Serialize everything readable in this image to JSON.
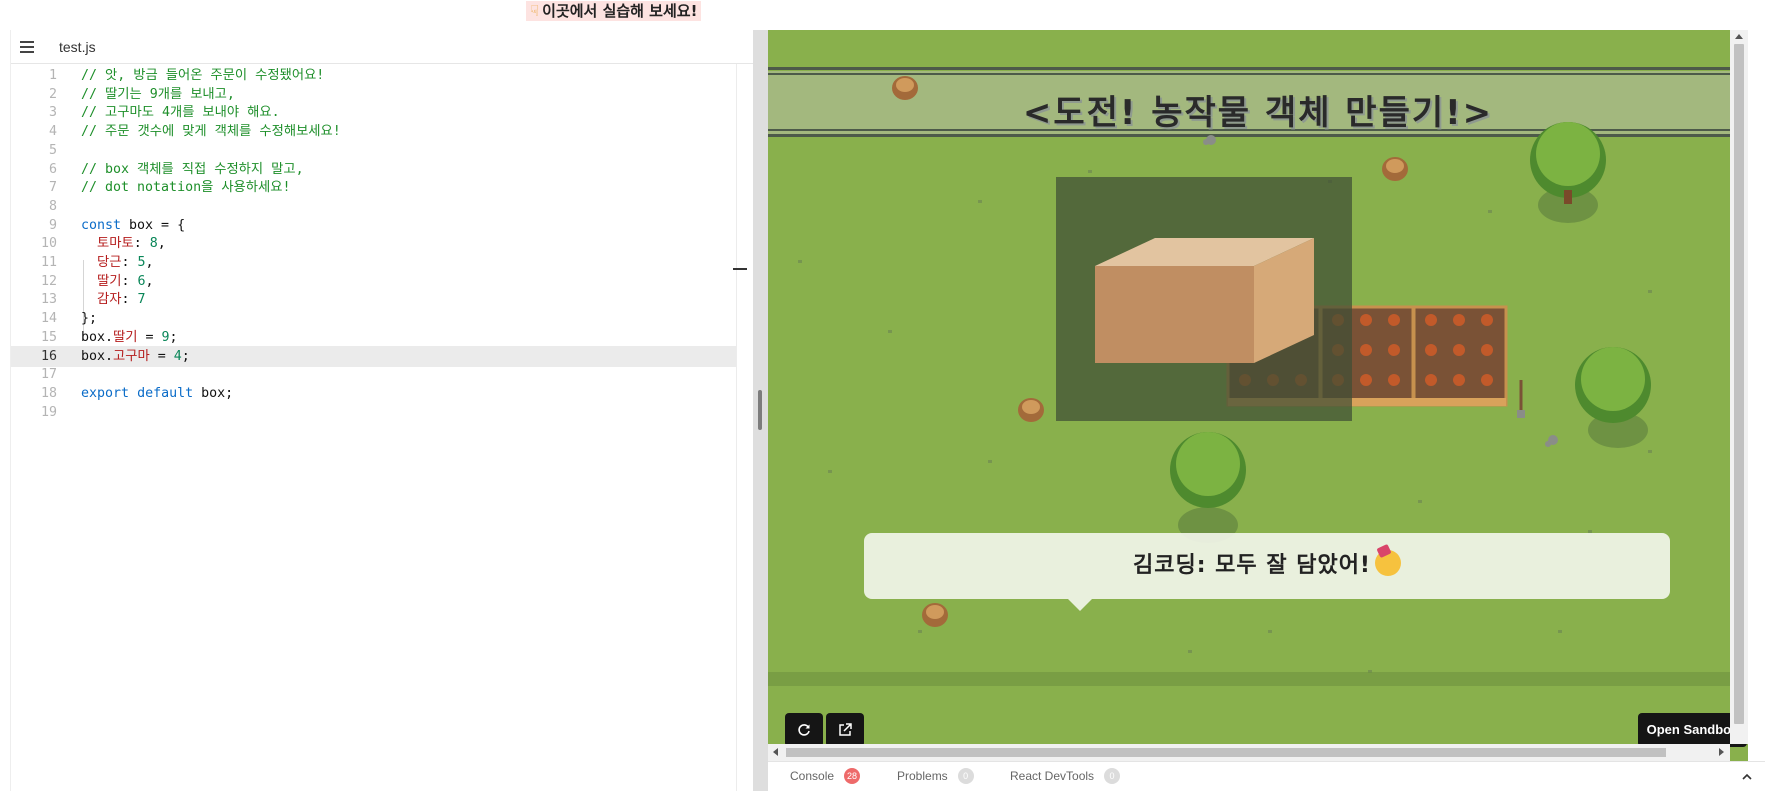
{
  "banner": {
    "text": "이곳에서 실습해 보세요!",
    "icon": "pointing-hand-icon"
  },
  "editor": {
    "file_tab": "test.js",
    "active_line": 16,
    "lines": [
      [
        {
          "t": "// 앗, 방금 들어온 주문이 수정됐어요!",
          "c": "c"
        }
      ],
      [
        {
          "t": "// 딸기는 9개를 보내고,",
          "c": "c"
        }
      ],
      [
        {
          "t": "// 고구마도 4개를 보내야 해요.",
          "c": "c"
        }
      ],
      [
        {
          "t": "// 주문 갯수에 맞게 객체를 수정해보세요!",
          "c": "c"
        }
      ],
      [],
      [
        {
          "t": "// box 객체를 직접 수정하지 말고,",
          "c": "c"
        }
      ],
      [
        {
          "t": "// dot notation을 사용하세요!",
          "c": "c"
        }
      ],
      [],
      [
        {
          "t": "const",
          "c": "k"
        },
        {
          "t": " box = {",
          "c": "t"
        }
      ],
      [
        {
          "t": "  ",
          "c": "t"
        },
        {
          "t": "토마토",
          "c": "p"
        },
        {
          "t": ": ",
          "c": "t"
        },
        {
          "t": "8",
          "c": "n"
        },
        {
          "t": ",",
          "c": "t"
        }
      ],
      [
        {
          "t": "  ",
          "c": "t"
        },
        {
          "t": "당근",
          "c": "p"
        },
        {
          "t": ": ",
          "c": "t"
        },
        {
          "t": "5",
          "c": "n"
        },
        {
          "t": ",",
          "c": "t"
        }
      ],
      [
        {
          "t": "  ",
          "c": "t"
        },
        {
          "t": "딸기",
          "c": "p"
        },
        {
          "t": ": ",
          "c": "t"
        },
        {
          "t": "6",
          "c": "n"
        },
        {
          "t": ",",
          "c": "t"
        }
      ],
      [
        {
          "t": "  ",
          "c": "t"
        },
        {
          "t": "감자",
          "c": "p"
        },
        {
          "t": ": ",
          "c": "t"
        },
        {
          "t": "7",
          "c": "n"
        }
      ],
      [
        {
          "t": "};",
          "c": "t"
        }
      ],
      [
        {
          "t": "box.",
          "c": "t"
        },
        {
          "t": "딸기",
          "c": "p"
        },
        {
          "t": " = ",
          "c": "t"
        },
        {
          "t": "9",
          "c": "n"
        },
        {
          "t": ";",
          "c": "t"
        }
      ],
      [
        {
          "t": "box.",
          "c": "t"
        },
        {
          "t": "고구마",
          "c": "p"
        },
        {
          "t": " = ",
          "c": "t"
        },
        {
          "t": "4",
          "c": "n"
        },
        {
          "t": ";",
          "c": "t"
        }
      ],
      [],
      [
        {
          "t": "export",
          "c": "k"
        },
        {
          "t": " ",
          "c": "t"
        },
        {
          "t": "default",
          "c": "k"
        },
        {
          "t": " box;",
          "c": "t"
        }
      ],
      []
    ]
  },
  "preview": {
    "title": "<도전! 농작물 객체 만들기!>",
    "dialog": "김코딩: 모두 잘 담았어!",
    "dialog_emoji": "partying-face-icon",
    "refresh_icon": "refresh-icon",
    "external_icon": "open-external-icon",
    "open_sandbox": "Open Sandbox"
  },
  "devtools": {
    "tabs": [
      {
        "label": "Console",
        "count": "28",
        "color": "#ee6a6a"
      },
      {
        "label": "Problems",
        "count": "0",
        "color": "#dcdcdc"
      },
      {
        "label": "React DevTools",
        "count": "0",
        "color": "#dcdcdc"
      }
    ],
    "collapse_icon": "chevron-up-icon"
  },
  "colors": {
    "comment": "#1e8f2a",
    "keyword": "#0b6cc8",
    "property": "#b51d1d",
    "number": "#098658",
    "grass": "#89b04c"
  }
}
